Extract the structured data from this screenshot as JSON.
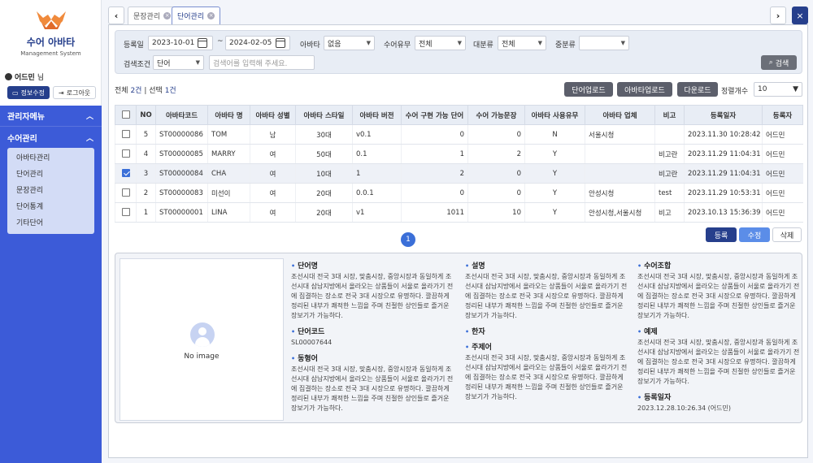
{
  "brand": {
    "title": "수어 아바타",
    "subtitle": "Management System"
  },
  "user": {
    "name": "어드민",
    "suffix": "님",
    "profile_btn": "정보수정",
    "logout_btn": "로그아웃"
  },
  "menu": {
    "admin_menu": "관리자메뉴",
    "sign_admin": "수어관리",
    "items": [
      "아바타관리",
      "단어관리",
      "문장관리",
      "단어통계",
      "기타단어"
    ]
  },
  "tabs": [
    {
      "label": "문장관리",
      "active": false
    },
    {
      "label": "단어관리",
      "active": true
    }
  ],
  "search": {
    "reg_date_label": "등록일",
    "date_from": "2023-10-01",
    "tilde": "~",
    "date_to": "2024-02-05",
    "avatar_label": "아바타",
    "avatar_value": "없음",
    "sign_label": "수어유무",
    "sign_value": "전체",
    "major_label": "대분류",
    "major_value": "전체",
    "mid_label": "중분류",
    "mid_value": "",
    "cond_label": "검색조건",
    "cond_value": "단어",
    "keyword_placeholder": "검색어를 입력해 주세요.",
    "search_btn": "검색"
  },
  "toolbar": {
    "total_prefix": "전체",
    "total_num": "2건",
    "sep": "|",
    "sel_prefix": "선택",
    "sel_num": "1건",
    "btn_word_upload": "단어업로드",
    "btn_avatar_upload": "아바타업로드",
    "btn_download": "다운로드",
    "page_size_label": "정렬개수",
    "page_size": "10"
  },
  "table": {
    "headers": [
      "",
      "NO",
      "아바타코드",
      "아바타 명",
      "아바타 성별",
      "아바타 스타일",
      "아바타 버전",
      "수어 구현 가능 단어",
      "수어 가능문장",
      "아바타 사용유무",
      "아바타 업체",
      "비고",
      "등록일자",
      "등록자"
    ],
    "rows": [
      {
        "checked": false,
        "no": "5",
        "code": "ST00000086",
        "name": "TOM",
        "gender": "남",
        "style": "30대",
        "version": "v0.1",
        "words": "0",
        "sentences": "0",
        "use": "N",
        "vendor": "서울시청",
        "note": "",
        "date": "2023.11.30 10:28:42",
        "by": "어드민"
      },
      {
        "checked": false,
        "no": "4",
        "code": "ST00000085",
        "name": "MARRY",
        "gender": "여",
        "style": "50대",
        "version": "0.1",
        "words": "1",
        "sentences": "2",
        "use": "Y",
        "vendor": "",
        "note": "비고란",
        "date": "2023.11.29 11:04:31",
        "by": "어드민"
      },
      {
        "checked": true,
        "no": "3",
        "code": "ST00000084",
        "name": "CHA",
        "gender": "여",
        "style": "10대",
        "version": "1",
        "words": "2",
        "sentences": "0",
        "use": "Y",
        "vendor": "",
        "note": "비고란",
        "date": "2023.11.29 11:04:31",
        "by": "어드민"
      },
      {
        "checked": false,
        "no": "2",
        "code": "ST00000083",
        "name": "미선이",
        "gender": "여",
        "style": "20대",
        "version": "0.0.1",
        "words": "0",
        "sentences": "0",
        "use": "Y",
        "vendor": "안성시청",
        "note": "test",
        "date": "2023.11.29 10:53:31",
        "by": "어드민"
      },
      {
        "checked": false,
        "no": "1",
        "code": "ST00000001",
        "name": "LINA",
        "gender": "여",
        "style": "20대",
        "version": "v1",
        "words": "1011",
        "sentences": "10",
        "use": "Y",
        "vendor": "안성시청,서울시청",
        "note": "비고",
        "date": "2023.10.13 15:36:39",
        "by": "어드민"
      }
    ]
  },
  "pagination": {
    "current": "1"
  },
  "actions": {
    "register": "등록",
    "edit": "수정",
    "delete": "삭제"
  },
  "detail": {
    "no_image": "No image",
    "word_name": {
      "title": "단어명",
      "value": "조선시대 전국 3대 시장, 맞춤시장, 중앙시장과 동일하게 조선시대 삼남지방에서 올라오는 상품들이 서울로 올라가기 전에 집결하는 장소로 전국 3대 시장으로 유명하다. 깔끔하게 정리된 내부가 쾌적한 느낌을 주며 친절한 상인들로 즐거운 장보기가 가능하다."
    },
    "word_code": {
      "title": "단어코드",
      "value": "SL00007644"
    },
    "synonym": {
      "title": "동형어",
      "value": "조선시대 전국 3대 시장, 맞춤시장, 중앙시장과 동일하게 조선시대 삼남지방에서 올라오는 상품들이 서울로 올라가기 전에 집결하는 장소로 전국 3대 시장으로 유명하다. 깔끔하게 정리된 내부가 쾌적한 느낌을 주며 친절한 상인들로 즐거운 장보기가 가능하다."
    },
    "desc": {
      "title": "설명",
      "value": "조선시대 전국 3대 시장, 맞춤시장, 중앙시장과 동일하게 조선시대 삼남지방에서 올라오는 상품들이 서울로 올라가기 전에 집결하는 장소로 전국 3대 시장으로 유명하다. 깔끔하게 정리된 내부가 쾌적한 느낌을 주며 친절한 상인들로 즐거운 장보기가 가능하다."
    },
    "hanja": {
      "title": "한자",
      "value": ""
    },
    "theme": {
      "title": "주제어",
      "value": "조선시대 전국 3대 시장, 맞춤시장, 중앙시장과 동일하게 조선시대 삼남지방에서 올라오는 상품들이 서울로 올라가기 전에 집결하는 장소로 전국 3대 시장으로 유명하다. 깔끔하게 정리된 내부가 쾌적한 느낌을 주며 친절한 상인들로 즐거운 장보기가 가능하다."
    },
    "combo": {
      "title": "수어조합",
      "value": "조선시대 전국 3대 시장, 맞춤시장, 중앙시장과 동일하게 조선시대 삼남지방에서 올라오는 상품들이 서울로 올라가기 전에 집결하는 장소로 전국 3대 시장으로 유명하다. 깔끔하게 정리된 내부가 쾌적한 느낌을 주며 친절한 상인들로 즐거운 장보기가 가능하다."
    },
    "example": {
      "title": "예제",
      "value": "조선시대 전국 3대 시장, 맞춤시장, 중앙시장과 동일하게 조선시대 삼남지방에서 올라오는 상품들이 서울로 올라가기 전에 집결하는 장소로 전국 3대 시장으로 유명하다. 깔끔하게 정리된 내부가 쾌적한 느낌을 주며 친절한 상인들로 즐거운 장보기가 가능하다."
    },
    "reg_date": {
      "title": "등록일자",
      "value": "2023.12.28.10:26.34 (어드민)"
    }
  },
  "colors": {
    "primary": "#263f8c",
    "menu_bg": "#3c5bd8",
    "accent": "#3b6fd8",
    "edit_btn": "#5b8de8"
  }
}
